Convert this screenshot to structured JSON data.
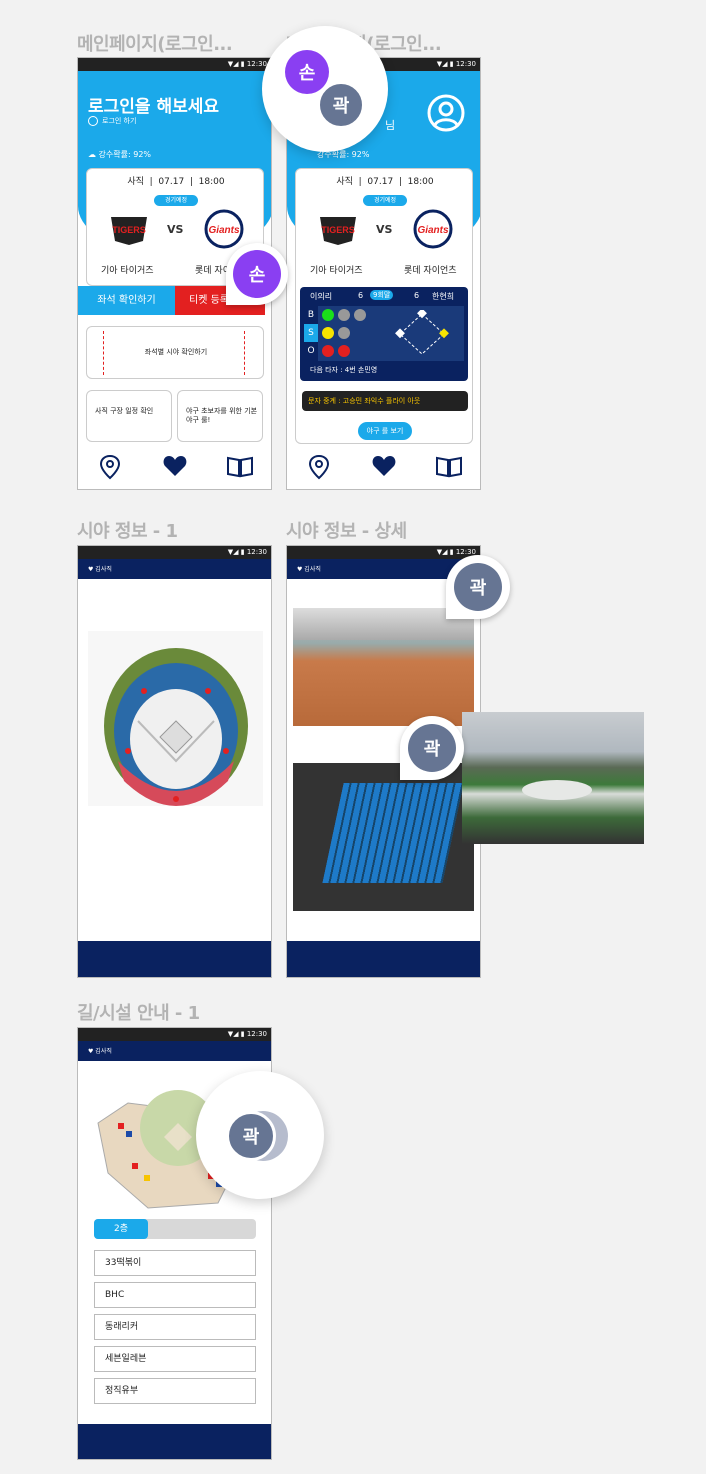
{
  "frames": {
    "main_login": "메인페이지(로그인...",
    "main_logged": "메인페이지(로그인...",
    "seat_info": "시야 정보 - 1",
    "seat_detail": "시야 정보 - 상세",
    "facility": "길/시설 안내 - 1"
  },
  "status_time": "12:30",
  "screen1": {
    "greeting": "로그인을 해보세요",
    "login_link": "로그인 하기",
    "rain": "강수확률: 92%",
    "venue": "사직",
    "date": "07.17",
    "time": "18:00",
    "badge": "경기예정",
    "vs": "VS",
    "home_team": "기아 타이거즈",
    "away_team": "롯데 자이언츠",
    "btn_seat": "좌석 확인하기",
    "btn_ticket": "티켓 등록",
    "seat_view": "좌석별 시야 확인하기",
    "tile1": "사직 구장 일정 확인",
    "tile2": "야구 초보자를 위한 기본 야구 룰!"
  },
  "screen2": {
    "greeting_tail": "님",
    "rain": "강수확률: 92%",
    "venue": "사직",
    "date": "07.17",
    "time": "18:00",
    "badge": "경기예정",
    "vs": "VS",
    "home_team": "기아 타이거즈",
    "away_team": "롯데 자이언츠",
    "score_left_name": "이의리",
    "score_left": "6",
    "inning": "9회말",
    "score_right": "6",
    "score_right_name": "한현희",
    "b": "B",
    "s": "S",
    "o": "O",
    "next_batter": "다음 타자 : 4번 손민영",
    "text_relay": "문자 중계 : 고승민 좌익수 플라이 아웃",
    "btn_more": "야구 를 보기"
  },
  "app_logo": "김사직",
  "facility": {
    "floor_tab": "2층",
    "items": [
      "33떡볶이",
      "BHC",
      "동래리커",
      "세븐일레븐",
      "정직유부"
    ]
  },
  "avatars": {
    "son": "손",
    "kwak": "곽"
  },
  "colors": {
    "sky": "#1ba9ea",
    "navy": "#0a2260",
    "red": "#e32020",
    "purple": "#8a3ff2",
    "slate": "#667593"
  }
}
